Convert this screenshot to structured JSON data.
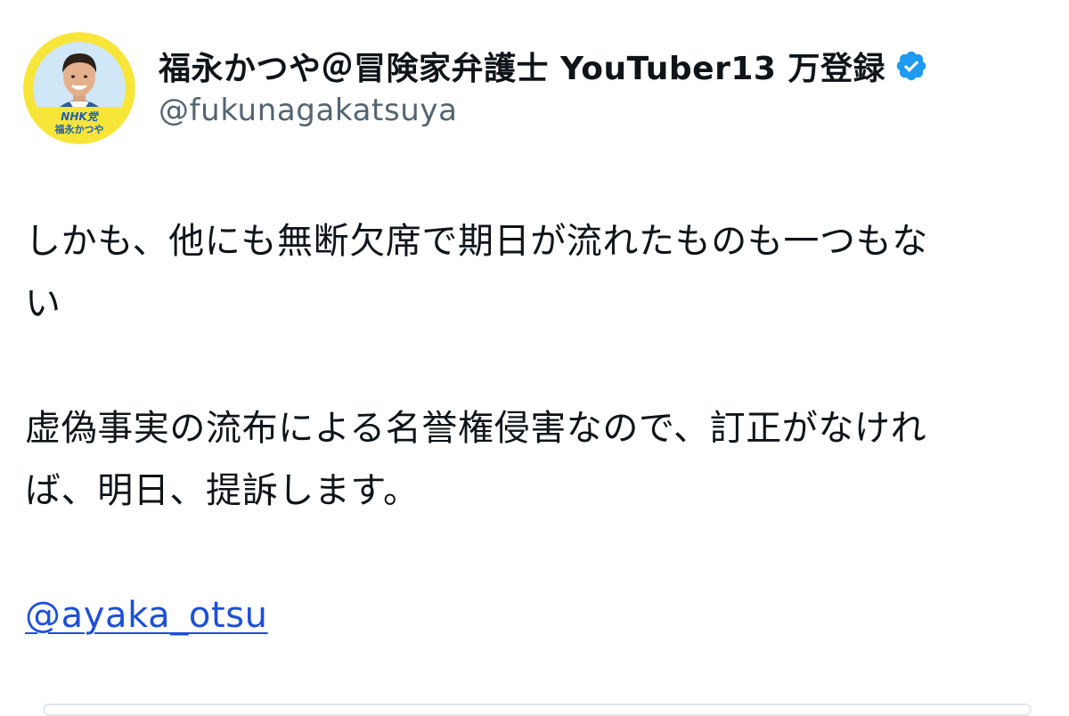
{
  "author": {
    "display_name": "福永かつや＠冒険家弁護士 YouTuber13 万登録",
    "handle": "@fukunagakatsuya",
    "verified": true,
    "avatar": {
      "badge_line1": "NHK党",
      "badge_line2": "福永かつや",
      "ring_color": "#f7e53a"
    }
  },
  "tweet": {
    "paragraph1": {
      "line1": "しかも、他にも無断欠席で期日が流れたものも一つもな",
      "line2": "い"
    },
    "paragraph2": {
      "line1": "虚偽事実の流布による名誉権侵害なので、訂正がなけれ",
      "line2": "ば、明日、提訴します。"
    },
    "mention": "@ayaka_otsu"
  },
  "colors": {
    "text": "#0f1419",
    "secondary": "#536471",
    "link": "#1d4fd8",
    "verified": "#1d9bf0"
  },
  "icons": {
    "verified": "verified-badge-icon"
  }
}
